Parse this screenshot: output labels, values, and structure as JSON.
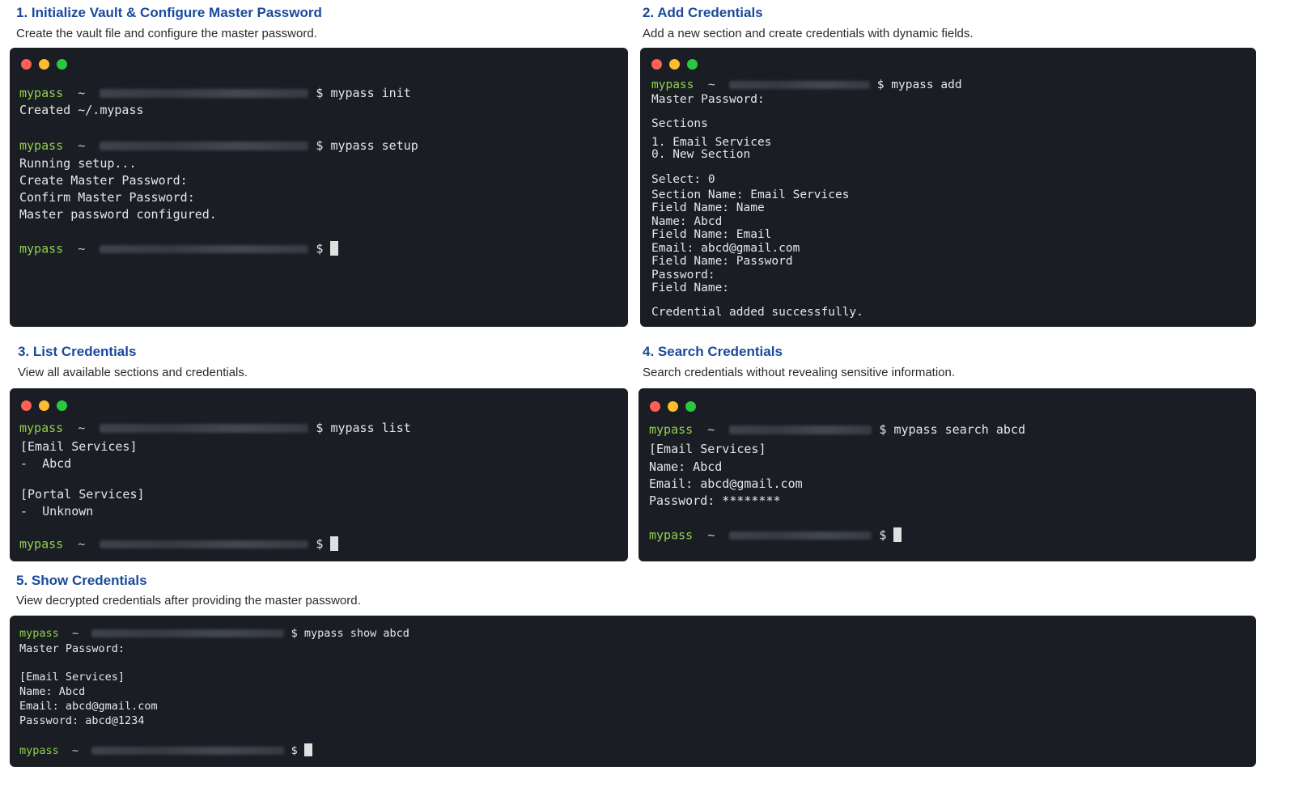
{
  "sections": [
    {
      "heading": "1. Initialize Vault & Configure Master Password",
      "description": "Create the vault file and configure the master password."
    },
    {
      "heading": "2. Add Credentials",
      "description": "Add a new section and create credentials with dynamic fields."
    },
    {
      "heading": "3. List Credentials",
      "description": "View all available sections and credentials."
    },
    {
      "heading": "4. Search Credentials",
      "description": "Search credentials without revealing sensitive information."
    },
    {
      "heading": "5. Show Credentials",
      "description": "View decrypted credentials after providing the master password."
    }
  ],
  "prompt": {
    "name": "mypass",
    "tilde": "~",
    "dollar": "$"
  },
  "terminal1": {
    "cmd_init": "mypass init",
    "out_init": [
      "Created ~/.mypass"
    ],
    "cmd_setup": "mypass setup",
    "out_setup": [
      "Running setup...",
      "Create Master Password:",
      "Confirm Master Password:",
      "Master password configured."
    ]
  },
  "terminal2": {
    "cmd_add": "mypass add",
    "out": [
      "Master Password:",
      "Sections",
      "1. Email Services",
      "0. New Section",
      "Select: 0",
      "Section Name: Email Services",
      "Field Name: Name",
      "Name: Abcd",
      "Field Name: Email",
      "Email: abcd@gmail.com",
      "Field Name: Password",
      "Password:",
      "Field Name:",
      "Credential added successfully."
    ]
  },
  "terminal3": {
    "cmd_list": "mypass list",
    "out": [
      "[Email Services]",
      "-  Abcd",
      "[Portal Services]",
      "-  Unknown"
    ]
  },
  "terminal4": {
    "cmd_search": "mypass search abcd",
    "out": [
      "[Email Services]",
      "Name: Abcd",
      "Email: abcd@gmail.com",
      "Password: ********"
    ]
  },
  "terminal5": {
    "cmd_show": "mypass show abcd",
    "out": [
      "Master Password:",
      "[Email Services]",
      "Name: Abcd",
      "Email: abcd@gmail.com",
      "Password: abcd@1234"
    ]
  }
}
